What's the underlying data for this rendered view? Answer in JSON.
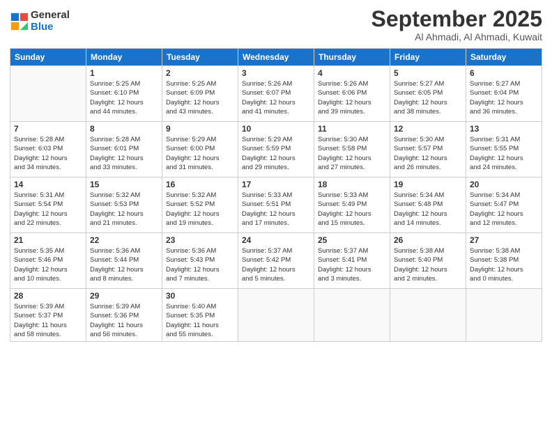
{
  "header": {
    "logo_general": "General",
    "logo_blue": "Blue",
    "month": "September 2025",
    "location": "Al Ahmadi, Al Ahmadi, Kuwait"
  },
  "days_of_week": [
    "Sunday",
    "Monday",
    "Tuesday",
    "Wednesday",
    "Thursday",
    "Friday",
    "Saturday"
  ],
  "weeks": [
    [
      {
        "day": "",
        "info": ""
      },
      {
        "day": "1",
        "info": "Sunrise: 5:25 AM\nSunset: 6:10 PM\nDaylight: 12 hours\nand 44 minutes."
      },
      {
        "day": "2",
        "info": "Sunrise: 5:25 AM\nSunset: 6:09 PM\nDaylight: 12 hours\nand 43 minutes."
      },
      {
        "day": "3",
        "info": "Sunrise: 5:26 AM\nSunset: 6:07 PM\nDaylight: 12 hours\nand 41 minutes."
      },
      {
        "day": "4",
        "info": "Sunrise: 5:26 AM\nSunset: 6:06 PM\nDaylight: 12 hours\nand 39 minutes."
      },
      {
        "day": "5",
        "info": "Sunrise: 5:27 AM\nSunset: 6:05 PM\nDaylight: 12 hours\nand 38 minutes."
      },
      {
        "day": "6",
        "info": "Sunrise: 5:27 AM\nSunset: 6:04 PM\nDaylight: 12 hours\nand 36 minutes."
      }
    ],
    [
      {
        "day": "7",
        "info": "Sunrise: 5:28 AM\nSunset: 6:03 PM\nDaylight: 12 hours\nand 34 minutes."
      },
      {
        "day": "8",
        "info": "Sunrise: 5:28 AM\nSunset: 6:01 PM\nDaylight: 12 hours\nand 33 minutes."
      },
      {
        "day": "9",
        "info": "Sunrise: 5:29 AM\nSunset: 6:00 PM\nDaylight: 12 hours\nand 31 minutes."
      },
      {
        "day": "10",
        "info": "Sunrise: 5:29 AM\nSunset: 5:59 PM\nDaylight: 12 hours\nand 29 minutes."
      },
      {
        "day": "11",
        "info": "Sunrise: 5:30 AM\nSunset: 5:58 PM\nDaylight: 12 hours\nand 27 minutes."
      },
      {
        "day": "12",
        "info": "Sunrise: 5:30 AM\nSunset: 5:57 PM\nDaylight: 12 hours\nand 26 minutes."
      },
      {
        "day": "13",
        "info": "Sunrise: 5:31 AM\nSunset: 5:55 PM\nDaylight: 12 hours\nand 24 minutes."
      }
    ],
    [
      {
        "day": "14",
        "info": "Sunrise: 5:31 AM\nSunset: 5:54 PM\nDaylight: 12 hours\nand 22 minutes."
      },
      {
        "day": "15",
        "info": "Sunrise: 5:32 AM\nSunset: 5:53 PM\nDaylight: 12 hours\nand 21 minutes."
      },
      {
        "day": "16",
        "info": "Sunrise: 5:32 AM\nSunset: 5:52 PM\nDaylight: 12 hours\nand 19 minutes."
      },
      {
        "day": "17",
        "info": "Sunrise: 5:33 AM\nSunset: 5:51 PM\nDaylight: 12 hours\nand 17 minutes."
      },
      {
        "day": "18",
        "info": "Sunrise: 5:33 AM\nSunset: 5:49 PM\nDaylight: 12 hours\nand 15 minutes."
      },
      {
        "day": "19",
        "info": "Sunrise: 5:34 AM\nSunset: 5:48 PM\nDaylight: 12 hours\nand 14 minutes."
      },
      {
        "day": "20",
        "info": "Sunrise: 5:34 AM\nSunset: 5:47 PM\nDaylight: 12 hours\nand 12 minutes."
      }
    ],
    [
      {
        "day": "21",
        "info": "Sunrise: 5:35 AM\nSunset: 5:46 PM\nDaylight: 12 hours\nand 10 minutes."
      },
      {
        "day": "22",
        "info": "Sunrise: 5:36 AM\nSunset: 5:44 PM\nDaylight: 12 hours\nand 8 minutes."
      },
      {
        "day": "23",
        "info": "Sunrise: 5:36 AM\nSunset: 5:43 PM\nDaylight: 12 hours\nand 7 minutes."
      },
      {
        "day": "24",
        "info": "Sunrise: 5:37 AM\nSunset: 5:42 PM\nDaylight: 12 hours\nand 5 minutes."
      },
      {
        "day": "25",
        "info": "Sunrise: 5:37 AM\nSunset: 5:41 PM\nDaylight: 12 hours\nand 3 minutes."
      },
      {
        "day": "26",
        "info": "Sunrise: 5:38 AM\nSunset: 5:40 PM\nDaylight: 12 hours\nand 2 minutes."
      },
      {
        "day": "27",
        "info": "Sunrise: 5:38 AM\nSunset: 5:38 PM\nDaylight: 12 hours\nand 0 minutes."
      }
    ],
    [
      {
        "day": "28",
        "info": "Sunrise: 5:39 AM\nSunset: 5:37 PM\nDaylight: 11 hours\nand 58 minutes."
      },
      {
        "day": "29",
        "info": "Sunrise: 5:39 AM\nSunset: 5:36 PM\nDaylight: 11 hours\nand 56 minutes."
      },
      {
        "day": "30",
        "info": "Sunrise: 5:40 AM\nSunset: 5:35 PM\nDaylight: 11 hours\nand 55 minutes."
      },
      {
        "day": "",
        "info": ""
      },
      {
        "day": "",
        "info": ""
      },
      {
        "day": "",
        "info": ""
      },
      {
        "day": "",
        "info": ""
      }
    ]
  ]
}
